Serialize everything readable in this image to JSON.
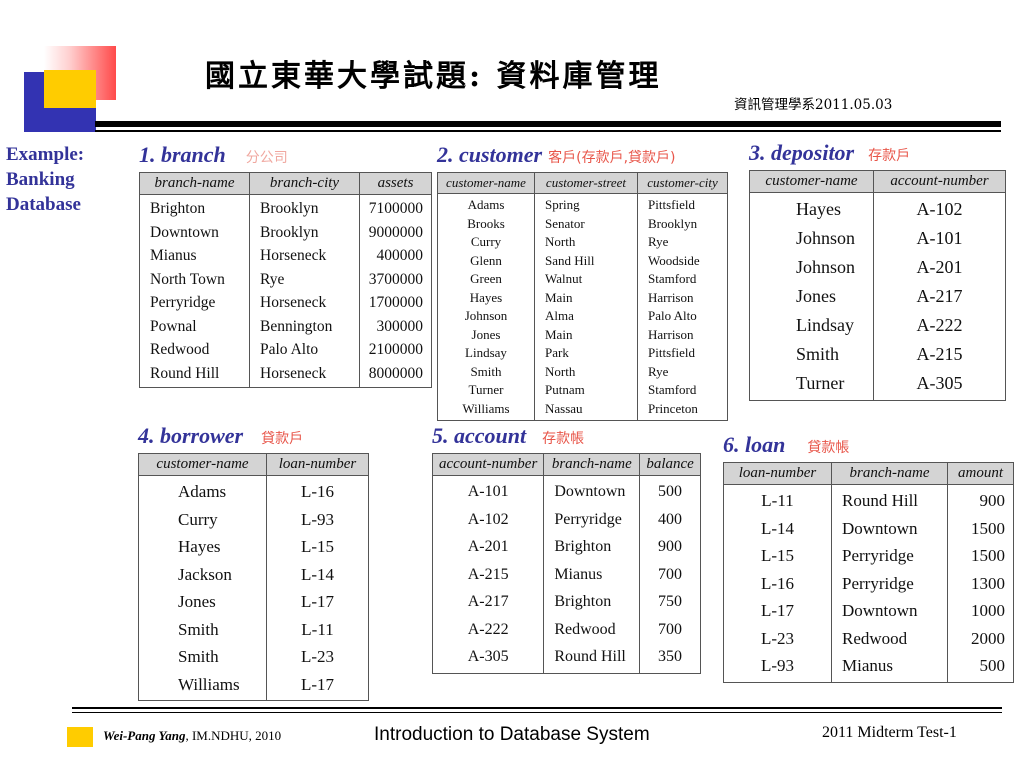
{
  "header": {
    "title": "國立東華大學試題: 資料庫管理",
    "subtitle": "資訊管理學系2011.05.03"
  },
  "example_label": {
    "line1": "Example:",
    "line2": "Banking",
    "line3": "Database"
  },
  "colors": {
    "heading_blue": "#333399",
    "annotation_red": "#e8564a",
    "annotation_pink": "#f0a8a0",
    "header_fill": "#d4d4d4",
    "logo_blue": "#3333b2",
    "logo_yellow": "#ffcc00",
    "logo_red": "#ff4a4a"
  },
  "tables": [
    {
      "title": "1. branch",
      "cn": "分公司",
      "columns": [
        "branch-name",
        "branch-city",
        "assets"
      ],
      "rows": [
        [
          "Brighton",
          "Brooklyn",
          "7100000"
        ],
        [
          "Downtown",
          "Brooklyn",
          "9000000"
        ],
        [
          "Mianus",
          "Horseneck",
          "400000"
        ],
        [
          "North Town",
          "Rye",
          "3700000"
        ],
        [
          "Perryridge",
          "Horseneck",
          "1700000"
        ],
        [
          "Pownal",
          "Bennington",
          "300000"
        ],
        [
          "Redwood",
          "Palo Alto",
          "2100000"
        ],
        [
          "Round Hill",
          "Horseneck",
          "8000000"
        ]
      ]
    },
    {
      "title": "2. customer",
      "cn": "客戶(存款戶,貸款戶)",
      "columns": [
        "customer-name",
        "customer-street",
        "customer-city"
      ],
      "rows": [
        [
          "Adams",
          "Spring",
          "Pittsfield"
        ],
        [
          "Brooks",
          "Senator",
          "Brooklyn"
        ],
        [
          "Curry",
          "North",
          "Rye"
        ],
        [
          "Glenn",
          "Sand Hill",
          "Woodside"
        ],
        [
          "Green",
          "Walnut",
          "Stamford"
        ],
        [
          "Hayes",
          "Main",
          "Harrison"
        ],
        [
          "Johnson",
          "Alma",
          "Palo Alto"
        ],
        [
          "Jones",
          "Main",
          "Harrison"
        ],
        [
          "Lindsay",
          "Park",
          "Pittsfield"
        ],
        [
          "Smith",
          "North",
          "Rye"
        ],
        [
          "Turner",
          "Putnam",
          "Stamford"
        ],
        [
          "Williams",
          "Nassau",
          "Princeton"
        ]
      ]
    },
    {
      "title": "3. depositor",
      "cn": "存款戶",
      "columns": [
        "customer-name",
        "account-number"
      ],
      "rows": [
        [
          "Hayes",
          "A-102"
        ],
        [
          "Johnson",
          "A-101"
        ],
        [
          "Johnson",
          "A-201"
        ],
        [
          "Jones",
          "A-217"
        ],
        [
          "Lindsay",
          "A-222"
        ],
        [
          "Smith",
          "A-215"
        ],
        [
          "Turner",
          "A-305"
        ]
      ]
    },
    {
      "title": "4. borrower",
      "cn": "貸款戶",
      "columns": [
        "customer-name",
        "loan-number"
      ],
      "rows": [
        [
          "Adams",
          "L-16"
        ],
        [
          "Curry",
          "L-93"
        ],
        [
          "Hayes",
          "L-15"
        ],
        [
          "Jackson",
          "L-14"
        ],
        [
          "Jones",
          "L-17"
        ],
        [
          "Smith",
          "L-11"
        ],
        [
          "Smith",
          "L-23"
        ],
        [
          "Williams",
          "L-17"
        ]
      ]
    },
    {
      "title": "5. account",
      "cn": "存款帳",
      "columns": [
        "account-number",
        "branch-name",
        "balance"
      ],
      "rows": [
        [
          "A-101",
          "Downtown",
          "500"
        ],
        [
          "A-102",
          "Perryridge",
          "400"
        ],
        [
          "A-201",
          "Brighton",
          "900"
        ],
        [
          "A-215",
          "Mianus",
          "700"
        ],
        [
          "A-217",
          "Brighton",
          "750"
        ],
        [
          "A-222",
          "Redwood",
          "700"
        ],
        [
          "A-305",
          "Round Hill",
          "350"
        ]
      ]
    },
    {
      "title": "6. loan",
      "cn": "貸款帳",
      "columns": [
        "loan-number",
        "branch-name",
        "amount"
      ],
      "rows": [
        [
          "L-11",
          "Round Hill",
          "900"
        ],
        [
          "L-14",
          "Downtown",
          "1500"
        ],
        [
          "L-15",
          "Perryridge",
          "1500"
        ],
        [
          "L-16",
          "Perryridge",
          "1300"
        ],
        [
          "L-17",
          "Downtown",
          "1000"
        ],
        [
          "L-23",
          "Redwood",
          "2000"
        ],
        [
          "L-93",
          "Mianus",
          "500"
        ]
      ]
    }
  ],
  "footer": {
    "author_italic": "Wei-Pang Yang",
    "author_rest": ", IM.NDHU, 2010",
    "center": "Introduction to Database System",
    "right": "2011 Midterm Test-1"
  }
}
